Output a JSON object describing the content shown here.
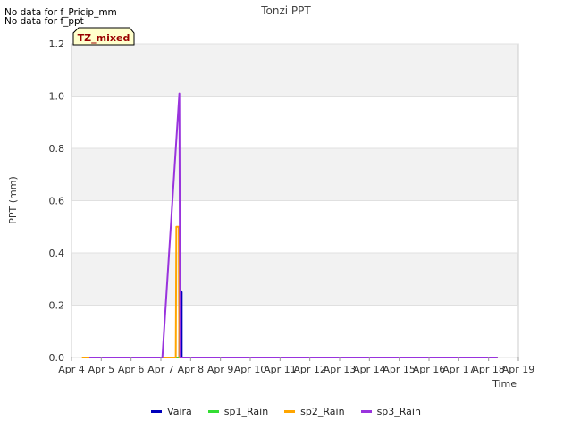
{
  "notices": [
    "No data for f_Pricip_mm",
    "No data for f_ppt"
  ],
  "site_tag": "TZ_mixed",
  "chart_data": {
    "type": "line",
    "title": "Tonzi PPT",
    "xlabel": "Time",
    "ylabel": "PPT (mm)",
    "xlim": [
      4,
      19
    ],
    "ylim": [
      0,
      1.2
    ],
    "x_ticks": [
      4,
      5,
      6,
      7,
      8,
      9,
      10,
      11,
      12,
      13,
      14,
      15,
      16,
      17,
      18,
      19
    ],
    "x_tick_labels": [
      "Apr 4",
      "Apr 5",
      "Apr 6",
      "Apr 7",
      "Apr 8",
      "Apr 9",
      "Apr 10",
      "Apr 11",
      "Apr 12",
      "Apr 13",
      "Apr 14",
      "Apr 15",
      "Apr 16",
      "Apr 17",
      "Apr 18",
      "Apr 19"
    ],
    "y_ticks": [
      0.0,
      0.2,
      0.4,
      0.6,
      0.8,
      1.0,
      1.2
    ],
    "y_tick_labels": [
      "0.0",
      "0.2",
      "0.4",
      "0.6",
      "0.8",
      "1.0",
      "1.2"
    ],
    "grid": true,
    "legend_position": "bottom-center",
    "series": [
      {
        "name": "Vaira",
        "color": "#0000bb",
        "mark": "line",
        "x": [
          7.62,
          7.62,
          7.7,
          7.7,
          7.78,
          18.3
        ],
        "y": [
          0,
          0.25,
          0.25,
          0,
          0,
          0
        ]
      },
      {
        "name": "sp1_Rain",
        "color": "#33dd33",
        "mark": "line",
        "x": [
          7.5,
          18.3
        ],
        "y": [
          0,
          0
        ]
      },
      {
        "name": "sp2_Rain",
        "color": "#ffa500",
        "mark": "line",
        "x": [
          4.35,
          4.55,
          7.05,
          7.5,
          7.52,
          7.6,
          7.62,
          18.3
        ],
        "y": [
          0,
          0,
          0,
          0,
          0.5,
          0.5,
          0,
          0
        ]
      },
      {
        "name": "sp3_Rain",
        "color": "#9933dd",
        "mark": "line",
        "x": [
          4.6,
          7.05,
          7.62,
          7.65,
          7.75,
          18.3
        ],
        "y": [
          0,
          0,
          1.01,
          0,
          0,
          0
        ]
      }
    ]
  }
}
